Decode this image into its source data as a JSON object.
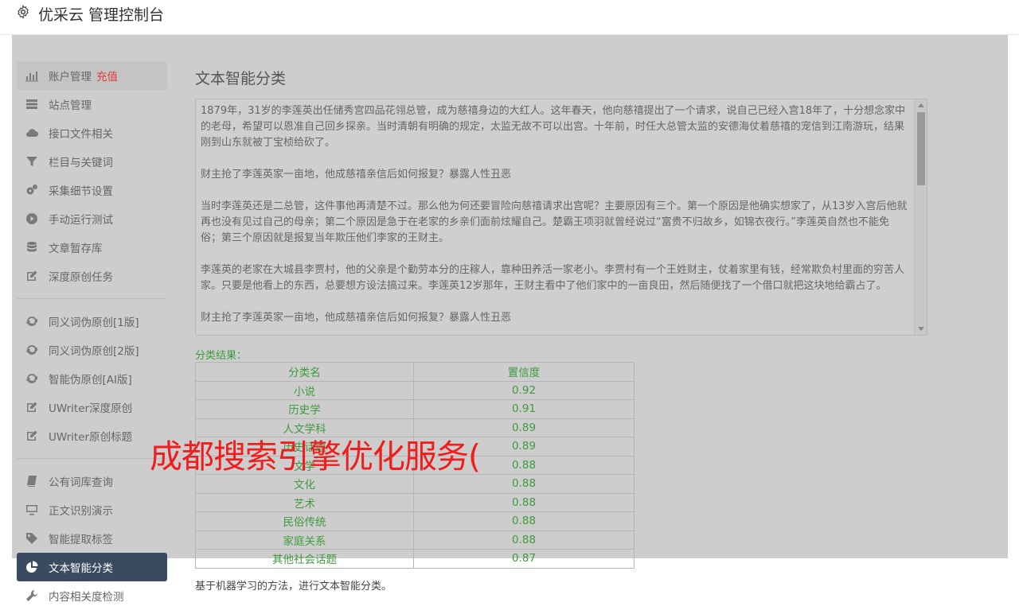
{
  "app": {
    "title": "优采云 管理控制台"
  },
  "sidebar": {
    "group1": [
      {
        "label": "账户管理",
        "badge": "充值"
      },
      {
        "label": "站点管理"
      },
      {
        "label": "接口文件相关"
      },
      {
        "label": "栏目与关键词"
      },
      {
        "label": "采集细节设置"
      },
      {
        "label": "手动运行测试"
      },
      {
        "label": "文章暂存库"
      },
      {
        "label": "深度原创任务"
      }
    ],
    "group2": [
      {
        "label": "同义词伪原创[1版]"
      },
      {
        "label": "同义词伪原创[2版]"
      },
      {
        "label": "智能伪原创[AI版]"
      },
      {
        "label": "UWriter深度原创"
      },
      {
        "label": "UWriter原创标题"
      }
    ],
    "group3": [
      {
        "label": "公有词库查询"
      },
      {
        "label": "正文识别演示"
      },
      {
        "label": "智能提取标签"
      },
      {
        "label": "文本智能分类"
      },
      {
        "label": "内容相关度检测"
      }
    ]
  },
  "main": {
    "title": "文本智能分类",
    "text_paragraphs": [
      "1879年，31岁的李莲英出任储秀宫四品花翎总管，成为慈禧身边的大红人。这年春天，他向慈禧提出了一个请求，说自己已经入宫18年了，十分想念家中的老母，希望可以恩准自己回乡探亲。当时清朝有明确的规定，太监无故不可以出宫。十年前，时任大总管太监的安德海仗着慈禧的宠信到江南游玩，结果刚到山东就被丁宝桢给砍了。",
      "财主抢了李莲英家一亩地，他成慈禧亲信后如何报复？暴露人性丑恶",
      "当时李莲英还是二总管，这件事他再清楚不过。那么他为何还要冒险向慈禧请求出宫呢？主要原因有三个。第一个原因是他确实想家了，从13岁入宫后他就再也没有见过自己的母亲；第二个原因是急于在老家的乡亲们面前炫耀自己。楚霸王项羽就曾经说过“富贵不归故乡，如锦衣夜行。”李莲英自然也不能免俗；第三个原因就是报复当年欺压他们李家的王财主。",
      "李莲英的老家在大城县李贾村，他的父亲是个勤劳本分的庄稼人，靠种田养活一家老小。李贾村有一个王姓财主，仗着家里有钱，经常欺负村里面的穷苦人家。只要是他看上的东西，总要想方设法搞过来。李莲英12岁那年，王财主看中了他们家中的一亩良田，然后随便找了一个借口就把这块地给霸占了。",
      "财主抢了李莲英家一亩地，他成慈禧亲信后如何报复？暴露人性丑恶"
    ],
    "result_label": "分类结果：",
    "table_headers": [
      "分类名",
      "置信度"
    ],
    "rows": [
      {
        "name": "小说",
        "score": "0.92"
      },
      {
        "name": "历史学",
        "score": "0.91"
      },
      {
        "name": "人文学科",
        "score": "0.89"
      },
      {
        "name": "历史话题",
        "score": "0.89"
      },
      {
        "name": "文学",
        "score": "0.88"
      },
      {
        "name": "文化",
        "score": "0.88"
      },
      {
        "name": "艺术",
        "score": "0.88"
      },
      {
        "name": "民俗传统",
        "score": "0.88"
      },
      {
        "name": "家庭关系",
        "score": "0.88"
      },
      {
        "name": "其他社会话题",
        "score": "0.87"
      }
    ],
    "description": "基于机器学习的方法，进行文本智能分类。"
  },
  "overlay_text": "成都搜索引擎优化服务(",
  "colors": {
    "accent_red": "#e03a3a",
    "result_green": "#3e9a3e",
    "active_nav": "#3a4a60",
    "overlay_red": "#f01d1d"
  }
}
